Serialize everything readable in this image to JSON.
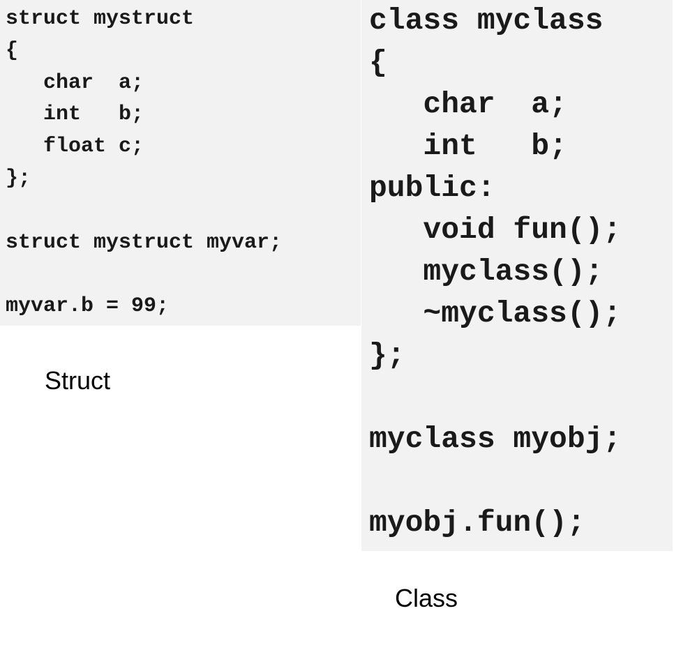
{
  "struct_example": {
    "caption": "Struct",
    "code": "struct mystruct\n{\n   char  a;\n   int   b;\n   float c;\n};\n\nstruct mystruct myvar;\n\nmyvar.b = 99;"
  },
  "class_example": {
    "caption": "Class",
    "code": "class myclass\n{\n   char  a;\n   int   b;\npublic:\n   void fun();\n   myclass();\n   ~myclass();\n};\n\nmyclass myobj;\n\nmyobj.fun();"
  }
}
